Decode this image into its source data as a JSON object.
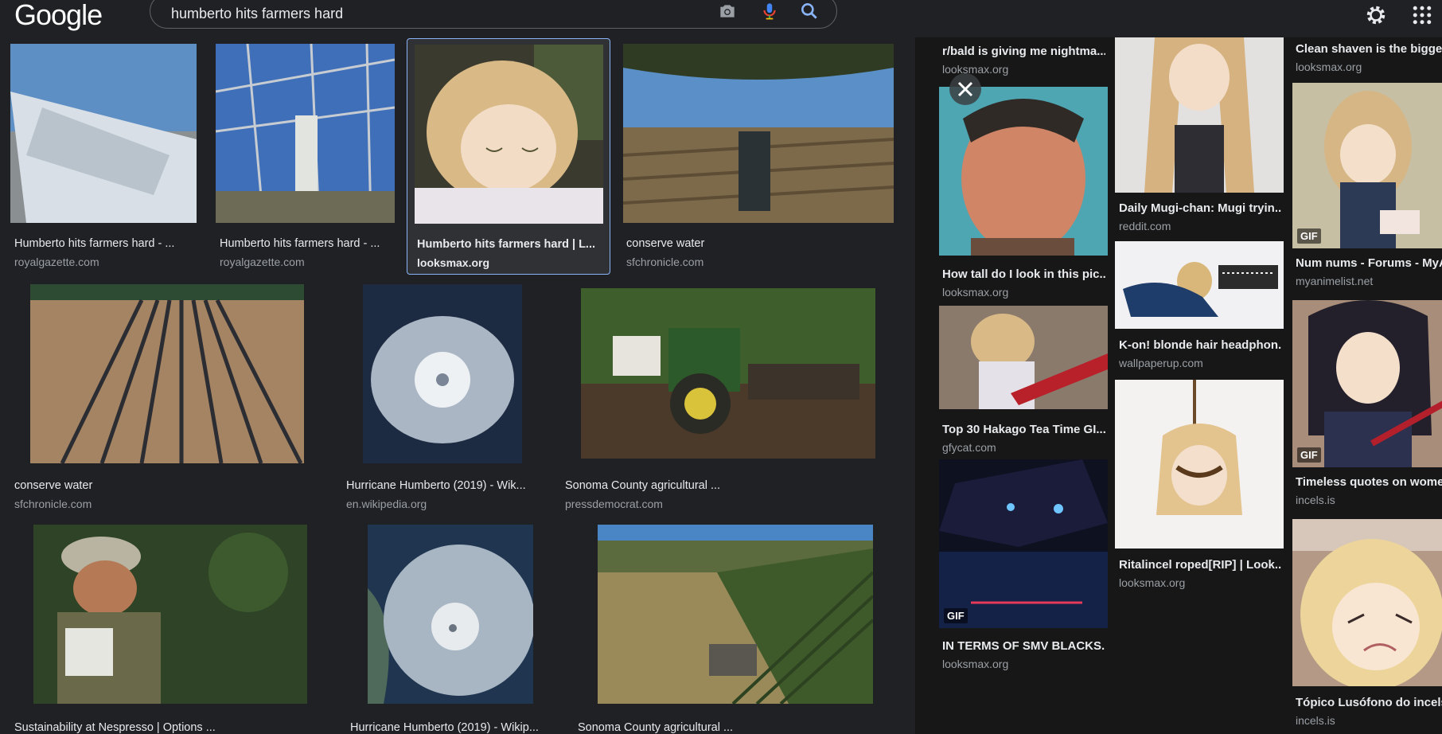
{
  "header": {
    "logo_text": "Google",
    "search_value": "humberto hits farmers hard",
    "icons": [
      "camera-icon",
      "microphone-icon",
      "search-icon",
      "gear-icon",
      "apps-grid-icon"
    ]
  },
  "results": [
    {
      "caption": "Humberto hits farmers hard - ...",
      "source": "royalgazette.com"
    },
    {
      "caption": "Humberto hits farmers hard - ...",
      "source": "royalgazette.com"
    },
    {
      "caption": "Humberto hits farmers hard | L...",
      "source": "looksmax.org"
    },
    {
      "caption": "conserve water",
      "source": "sfchronicle.com"
    },
    {
      "caption": "conserve water",
      "source": "sfchronicle.com"
    },
    {
      "caption": "Hurricane Humberto (2019) - Wik...",
      "source": "en.wikipedia.org"
    },
    {
      "caption": "Sonoma County agricultural ...",
      "source": "pressdemocrat.com"
    },
    {
      "caption": "Sustainability at Nespresso | Options ...",
      "source": ""
    },
    {
      "caption": "Hurricane Humberto (2019) - Wikip...",
      "source": ""
    },
    {
      "caption": "Sonoma County agricultural ...",
      "source": ""
    }
  ],
  "side": {
    "col1": [
      {
        "caption": "r/bald is giving me nightma...",
        "source": "looksmax.org"
      },
      {
        "caption": "How tall do I look in this pic...",
        "source": "looksmax.org"
      },
      {
        "caption": "Top 30 Hakago Tea Time GI...",
        "source": "gfycat.com"
      },
      {
        "caption": "IN TERMS OF SMV BLACKS...",
        "source": "looksmax.org",
        "badge": "GIF"
      }
    ],
    "col2": [
      {
        "caption": "Daily Mugi-chan: Mugi tryin...",
        "source": "reddit.com"
      },
      {
        "caption": "K-on! blonde hair headphon...",
        "source": "wallpaperup.com"
      },
      {
        "caption": "Ritalincel roped[RIP] | Look...",
        "source": "looksmax.org"
      }
    ],
    "col3": [
      {
        "caption": "Clean shaven is the bigges",
        "source": "looksmax.org"
      },
      {
        "caption": "Num nums - Forums - MyA",
        "source": "myanimelist.net",
        "badge": "GIF"
      },
      {
        "caption": "Timeless quotes on wome",
        "source": "incels.is",
        "badge": "GIF"
      },
      {
        "caption": "Tópico Lusófono do incels",
        "source": "incels.is"
      }
    ]
  },
  "colors": {
    "background": "#202124",
    "side_panel": "#171717",
    "accent": "#8ab4f8",
    "secondary_text": "#9aa0a6"
  }
}
